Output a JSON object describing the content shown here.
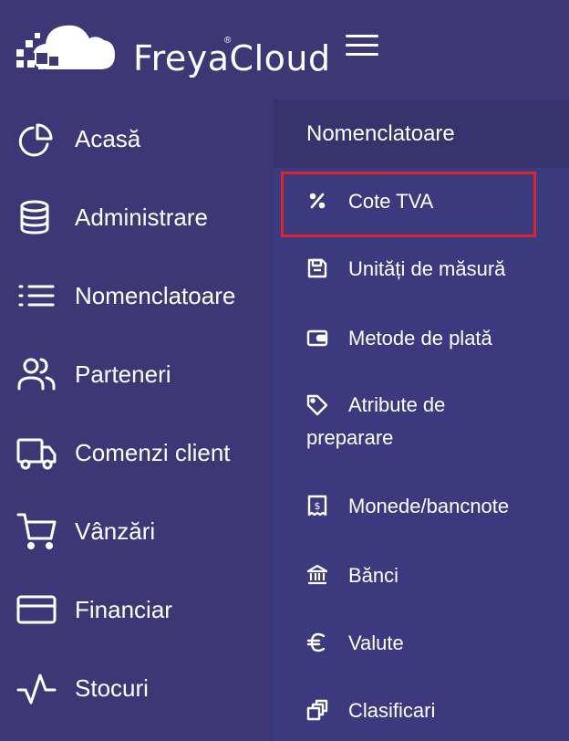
{
  "app": {
    "brand_name": "FreyaCloud",
    "brand_reg": "®"
  },
  "sidebar": {
    "items": [
      {
        "label": "Acasă",
        "icon": "pie-chart-icon"
      },
      {
        "label": "Administrare",
        "icon": "database-icon"
      },
      {
        "label": "Nomenclatoare",
        "icon": "list-icon"
      },
      {
        "label": "Parteneri",
        "icon": "users-icon"
      },
      {
        "label": "Comenzi client",
        "icon": "truck-icon"
      },
      {
        "label": "Vânzări",
        "icon": "cart-icon"
      },
      {
        "label": "Financiar",
        "icon": "credit-card-icon"
      },
      {
        "label": "Stocuri",
        "icon": "activity-icon"
      }
    ]
  },
  "submenu": {
    "title": "Nomenclatoare",
    "items": [
      {
        "label": "Cote TVA",
        "icon": "percent-icon"
      },
      {
        "label": "Unități de măsură",
        "icon": "save-icon"
      },
      {
        "label": "Metode de plată",
        "icon": "wallet-icon"
      },
      {
        "label": "Atribute de preparare",
        "icon": "tag-icon"
      },
      {
        "label": "Monede/bancnote",
        "icon": "receipt-icon"
      },
      {
        "label": "Bănci",
        "icon": "bank-icon"
      },
      {
        "label": "Valute",
        "icon": "euro-icon"
      },
      {
        "label": "Clasificari",
        "icon": "layers-icon"
      }
    ],
    "highlighted_item": "Cote TVA"
  },
  "colors": {
    "background": "#3d3775",
    "submenu_bg": "#3b3a7f",
    "submenu_header_bg": "#35346c",
    "highlight_border": "#d9262e",
    "text": "#ffffff"
  }
}
